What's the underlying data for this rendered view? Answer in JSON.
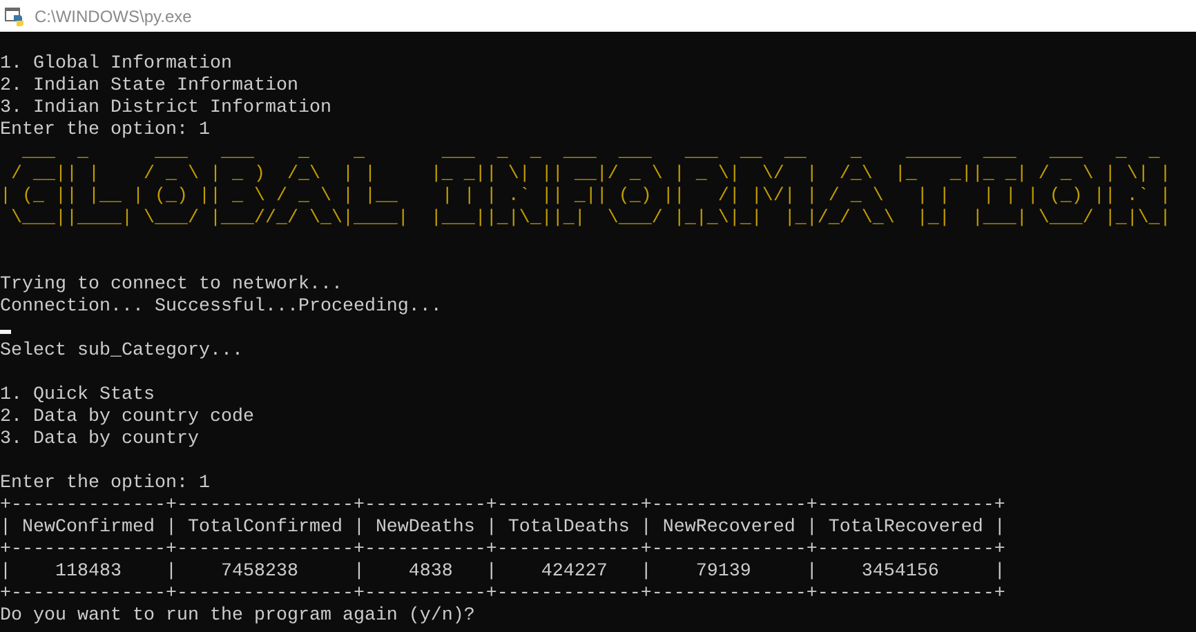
{
  "window": {
    "title": "C:\\WINDOWS\\py.exe"
  },
  "console": {
    "lines": [
      {
        "kind": "text",
        "text": "1. Global Information"
      },
      {
        "kind": "text",
        "text": "2. Indian State Information"
      },
      {
        "kind": "text",
        "text": "3. Indian District Information"
      },
      {
        "kind": "text",
        "text": "Enter the option: 1"
      },
      {
        "kind": "art",
        "text": "  ___  _      ___   ___    _    _       ___  _  _  ___  ___   ___  __  __    _    _____  ___   ___   _  _ "
      },
      {
        "kind": "art",
        "text": " / __|| |    / _ \\ | _ )  /_\\  | |     |_ _|| \\| || __|/ _ \\ | _ \\|  \\/  |  /_\\  |_   _||_ _| / _ \\ | \\| |"
      },
      {
        "kind": "art",
        "text": "| (_ || |__ | (_) || _ \\ / _ \\ | |__    | | | .` || _|| (_) ||   /| |\\/| | / _ \\   | |   | | | (_) || .` |"
      },
      {
        "kind": "art",
        "text": " \\___||____| \\___/ |___//_/ \\_\\|____|  |___||_|\\_||_|  \\___/ |_|_\\|_|  |_|/_/ \\_\\  |_|  |___| \\___/ |_|\\_|"
      },
      {
        "kind": "blank"
      },
      {
        "kind": "blank"
      },
      {
        "kind": "text",
        "text": "Trying to connect to network..."
      },
      {
        "kind": "text",
        "text": "Connection... Successful...Proceeding..."
      },
      {
        "kind": "cursor"
      },
      {
        "kind": "text",
        "text": "Select sub_Category..."
      },
      {
        "kind": "blank"
      },
      {
        "kind": "text",
        "text": "1. Quick Stats"
      },
      {
        "kind": "text",
        "text": "2. Data by country code"
      },
      {
        "kind": "text",
        "text": "3. Data by country"
      },
      {
        "kind": "blank"
      },
      {
        "kind": "text",
        "text": "Enter the option: 1"
      },
      {
        "kind": "text",
        "text": "+--------------+----------------+-----------+-------------+--------------+----------------+"
      },
      {
        "kind": "text",
        "text": "| NewConfirmed | TotalConfirmed | NewDeaths | TotalDeaths | NewRecovered | TotalRecovered |"
      },
      {
        "kind": "text",
        "text": "+--------------+----------------+-----------+-------------+--------------+----------------+"
      },
      {
        "kind": "text",
        "text": "|    118483    |    7458238     |    4838   |    424227   |    79139     |    3454156     |"
      },
      {
        "kind": "text",
        "text": "+--------------+----------------+-----------+-------------+--------------+----------------+"
      },
      {
        "kind": "text",
        "text": "Do you want to run the program again (y/n)?"
      }
    ]
  }
}
